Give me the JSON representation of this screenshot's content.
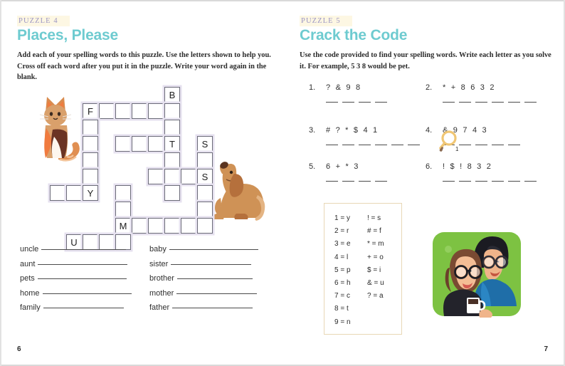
{
  "left_page": {
    "tag": "PUZZLE 4",
    "title": "Places, Please",
    "instructions": "Add each of your spelling words to this puzzle. Use the letters shown to help you. Cross off each word after you put it in the puzzle. Write your word again in the blank.",
    "page_number": "6",
    "crossword": {
      "given_letters": [
        "B",
        "F",
        "T",
        "S",
        "S",
        "Y",
        "M",
        "U"
      ],
      "cells": [
        {
          "col": 7,
          "row": 0,
          "letter": "B"
        },
        {
          "col": 2,
          "row": 1,
          "letter": "F"
        },
        {
          "col": 3,
          "row": 1,
          "letter": ""
        },
        {
          "col": 4,
          "row": 1,
          "letter": ""
        },
        {
          "col": 5,
          "row": 1,
          "letter": ""
        },
        {
          "col": 6,
          "row": 1,
          "letter": ""
        },
        {
          "col": 7,
          "row": 1,
          "letter": ""
        },
        {
          "col": 2,
          "row": 2,
          "letter": ""
        },
        {
          "col": 7,
          "row": 2,
          "letter": ""
        },
        {
          "col": 2,
          "row": 3,
          "letter": ""
        },
        {
          "col": 4,
          "row": 3,
          "letter": ""
        },
        {
          "col": 5,
          "row": 3,
          "letter": ""
        },
        {
          "col": 6,
          "row": 3,
          "letter": ""
        },
        {
          "col": 7,
          "row": 3,
          "letter": "T"
        },
        {
          "col": 9,
          "row": 3,
          "letter": "S"
        },
        {
          "col": 2,
          "row": 4,
          "letter": ""
        },
        {
          "col": 7,
          "row": 4,
          "letter": ""
        },
        {
          "col": 9,
          "row": 4,
          "letter": ""
        },
        {
          "col": 2,
          "row": 5,
          "letter": ""
        },
        {
          "col": 6,
          "row": 5,
          "letter": ""
        },
        {
          "col": 7,
          "row": 5,
          "letter": ""
        },
        {
          "col": 8,
          "row": 5,
          "letter": ""
        },
        {
          "col": 9,
          "row": 5,
          "letter": "S"
        },
        {
          "col": 0,
          "row": 6,
          "letter": ""
        },
        {
          "col": 1,
          "row": 6,
          "letter": ""
        },
        {
          "col": 2,
          "row": 6,
          "letter": "Y"
        },
        {
          "col": 4,
          "row": 6,
          "letter": ""
        },
        {
          "col": 7,
          "row": 6,
          "letter": ""
        },
        {
          "col": 9,
          "row": 6,
          "letter": ""
        },
        {
          "col": 4,
          "row": 7,
          "letter": ""
        },
        {
          "col": 9,
          "row": 7,
          "letter": ""
        },
        {
          "col": 4,
          "row": 8,
          "letter": "M"
        },
        {
          "col": 5,
          "row": 8,
          "letter": ""
        },
        {
          "col": 6,
          "row": 8,
          "letter": ""
        },
        {
          "col": 7,
          "row": 8,
          "letter": ""
        },
        {
          "col": 8,
          "row": 8,
          "letter": ""
        },
        {
          "col": 9,
          "row": 8,
          "letter": ""
        },
        {
          "col": 1,
          "row": 9,
          "letter": "U"
        },
        {
          "col": 2,
          "row": 9,
          "letter": ""
        },
        {
          "col": 3,
          "row": 9,
          "letter": ""
        },
        {
          "col": 4,
          "row": 9,
          "letter": ""
        }
      ]
    },
    "word_list_left": [
      "uncle",
      "aunt",
      "pets",
      "home",
      "family"
    ],
    "word_list_right": [
      "baby",
      "sister",
      "brother",
      "mother",
      "father"
    ],
    "illustrations": [
      "cat-illustration",
      "dog-illustration"
    ]
  },
  "right_page": {
    "tag": "PUZZLE 5",
    "title": "Crack the Code",
    "instructions": "Use the code provided to find your spelling words. Write each letter as you solve it. For example, 5 3 8 would be pet.",
    "page_number": "7",
    "code_items": [
      {
        "number": "1.",
        "sequence": "? & 9 8",
        "blank_count": 4
      },
      {
        "number": "2.",
        "sequence": "* + 8 6 3 2",
        "blank_count": 6
      },
      {
        "number": "3.",
        "sequence": "# ? * $ 4 1",
        "blank_count": 6
      },
      {
        "number": "4.",
        "sequence": "& 9 7 4 3",
        "blank_count": 5
      },
      {
        "number": "5.",
        "sequence": "6 + * 3",
        "blank_count": 4
      },
      {
        "number": "6.",
        "sequence": "! $ ! 8 3 2",
        "blank_count": 6
      }
    ],
    "key_left": [
      "1 = y",
      "2 = r",
      "3 = e",
      "4 = l",
      "5 = p",
      "6 = h",
      "7 = c",
      "8 = t",
      "9 = n"
    ],
    "key_right": [
      "! = s",
      "# = f",
      "* = m",
      "+ = o",
      "$ = i",
      "& = u",
      "? = a"
    ],
    "illustrations": [
      "couple-illustration",
      "magnifying-glass-icon"
    ],
    "magnifier_label": "1"
  },
  "colors": {
    "title": "#6ecbd0",
    "tag_text": "#9b95c4",
    "tag_highlight": "#fdf7e3",
    "grid_line": "#6b6b78",
    "grid_glow": "#e6e1ef",
    "key_border": "#e8d7b5",
    "family_bg": "#7dc242"
  }
}
